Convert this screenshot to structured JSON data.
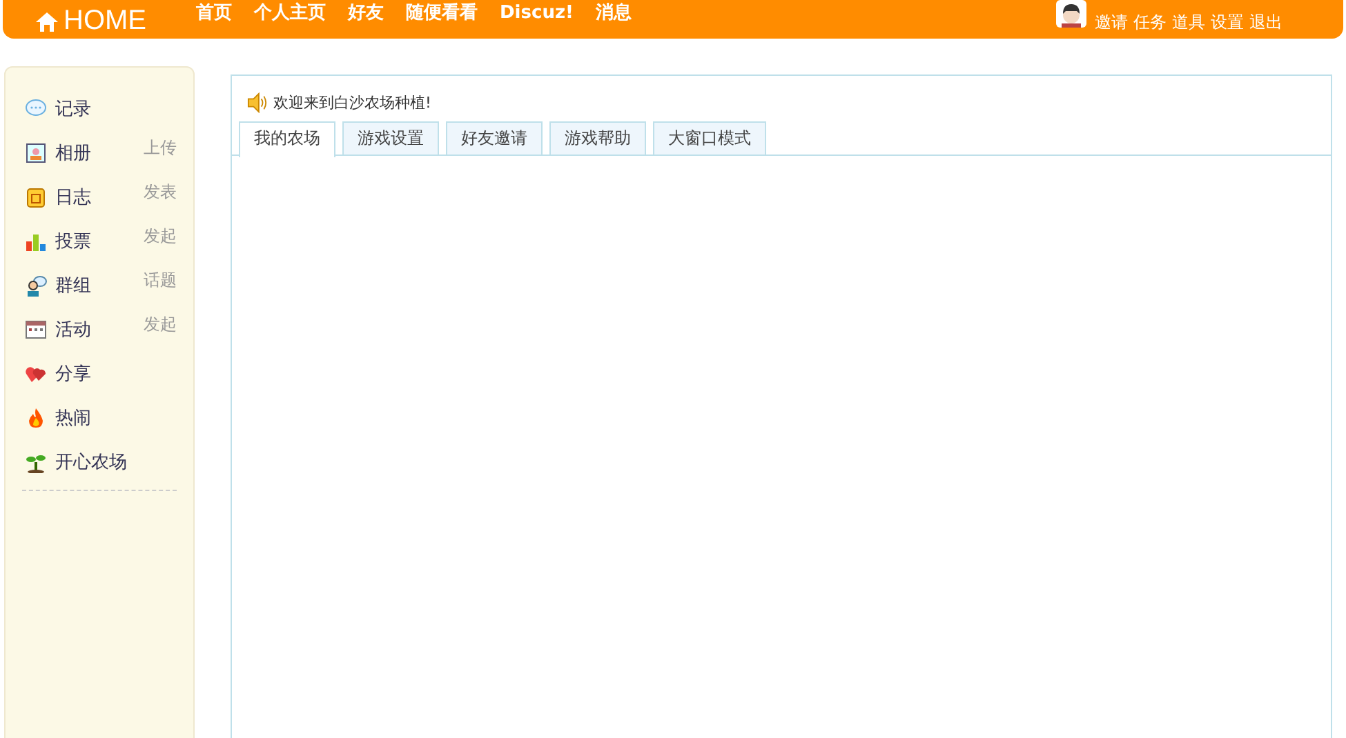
{
  "header": {
    "logo": "HOME",
    "nav": [
      {
        "label": "首页"
      },
      {
        "label": "个人主页"
      },
      {
        "label": "好友"
      },
      {
        "label": "随便看看"
      },
      {
        "label": "Discuz!"
      },
      {
        "label": "消息"
      }
    ],
    "user_links": [
      {
        "label": "邀请"
      },
      {
        "label": "任务"
      },
      {
        "label": "道具"
      },
      {
        "label": "设置"
      },
      {
        "label": "退出"
      }
    ]
  },
  "sidebar": {
    "items": [
      {
        "label": "记录"
      },
      {
        "label": "相册",
        "action": "上传"
      },
      {
        "label": "日志",
        "action": "发表"
      },
      {
        "label": "投票",
        "action": "发起"
      },
      {
        "label": "群组",
        "action": "话题"
      },
      {
        "label": "活动",
        "action": "发起"
      },
      {
        "label": "分享"
      },
      {
        "label": "热闹"
      },
      {
        "label": "开心农场"
      }
    ]
  },
  "main": {
    "notice": "欢迎来到白沙农场种植!",
    "tabs": [
      {
        "label": "我的农场",
        "selected": true
      },
      {
        "label": "游戏设置",
        "selected": false
      },
      {
        "label": "好友邀请",
        "selected": false
      },
      {
        "label": "游戏帮助",
        "selected": false
      },
      {
        "label": "大窗口模式",
        "selected": false
      }
    ]
  }
}
